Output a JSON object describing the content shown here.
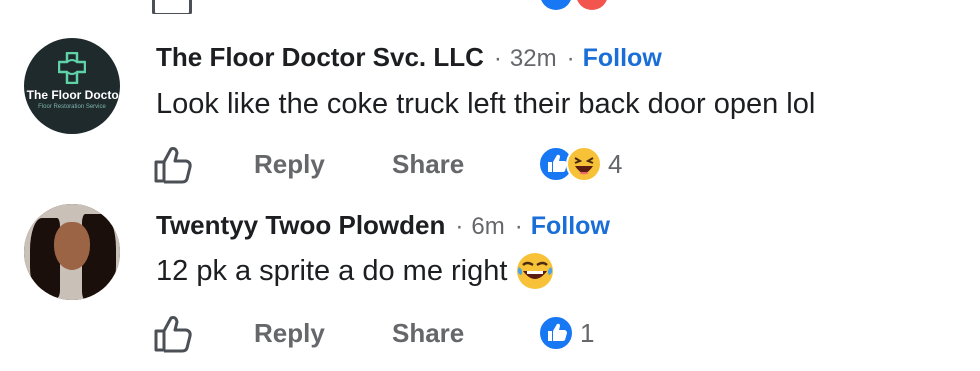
{
  "comments": [
    {
      "author": "The Floor Doctor Svc. LLC",
      "time": "32m",
      "follow_label": "Follow",
      "text": "Look like the coke truck left their back door open lol",
      "avatar": {
        "type": "logo",
        "logo_text": "The Floor Doctor",
        "logo_sub": "Floor Restoration Service",
        "icon": "medical-cross-icon"
      },
      "actions": {
        "reply_label": "Reply",
        "share_label": "Share"
      },
      "reactions": {
        "icons": [
          "like-icon",
          "haha-icon"
        ],
        "count": "4"
      }
    },
    {
      "author": "Twentyy Twoo Plowden",
      "time": "6m",
      "follow_label": "Follow",
      "text": "12 pk a sprite a do me right",
      "text_emoji": "laughing-emoji-icon",
      "avatar": {
        "type": "photo"
      },
      "actions": {
        "reply_label": "Reply",
        "share_label": "Share"
      },
      "reactions": {
        "icons": [
          "like-icon"
        ],
        "count": "1"
      }
    }
  ],
  "colors": {
    "follow": "#1a6ed8",
    "secondary_text": "#65676b",
    "like_blue": "#1877f2",
    "haha_yellow": "#f7c237"
  }
}
